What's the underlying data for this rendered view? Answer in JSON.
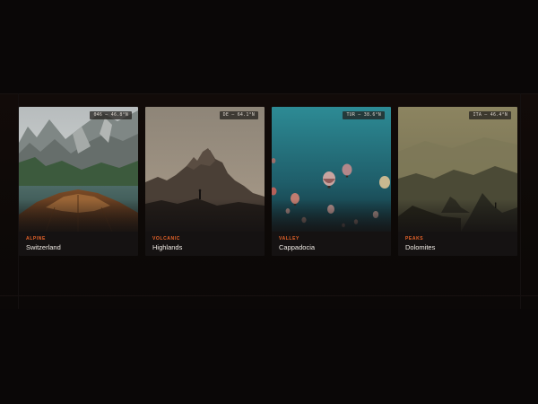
{
  "gallery": {
    "cards": [
      {
        "kind": "ALPINE",
        "place": "Switzerland",
        "coords": "046 — 46.8°N",
        "photo": "lake-boat-mountain-photo"
      },
      {
        "kind": "VOLCANIC",
        "place": "Highlands",
        "coords": "DE — 64.1°N",
        "photo": "volcanic-peak-silhouette-photo"
      },
      {
        "kind": "VALLEY",
        "place": "Cappadocia",
        "coords": "TUR — 38.6°N",
        "photo": "hot-air-balloons-photo"
      },
      {
        "kind": "PEAKS",
        "place": "Dolomites",
        "coords": "ITA — 46.4°N",
        "photo": "misty-peaks-photo"
      }
    ]
  },
  "colors": {
    "accent": "#e8642a",
    "background": "#0a0707",
    "card": "#151212",
    "text": "#f1ece6"
  }
}
